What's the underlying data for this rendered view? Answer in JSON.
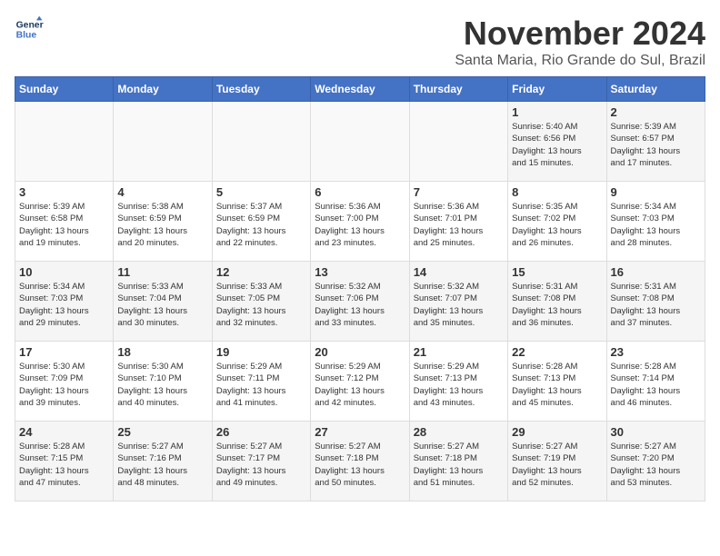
{
  "header": {
    "logo_line1": "General",
    "logo_line2": "Blue",
    "month": "November 2024",
    "location": "Santa Maria, Rio Grande do Sul, Brazil"
  },
  "weekdays": [
    "Sunday",
    "Monday",
    "Tuesday",
    "Wednesday",
    "Thursday",
    "Friday",
    "Saturday"
  ],
  "weeks": [
    [
      {
        "day": "",
        "info": ""
      },
      {
        "day": "",
        "info": ""
      },
      {
        "day": "",
        "info": ""
      },
      {
        "day": "",
        "info": ""
      },
      {
        "day": "",
        "info": ""
      },
      {
        "day": "1",
        "info": "Sunrise: 5:40 AM\nSunset: 6:56 PM\nDaylight: 13 hours\nand 15 minutes."
      },
      {
        "day": "2",
        "info": "Sunrise: 5:39 AM\nSunset: 6:57 PM\nDaylight: 13 hours\nand 17 minutes."
      }
    ],
    [
      {
        "day": "3",
        "info": "Sunrise: 5:39 AM\nSunset: 6:58 PM\nDaylight: 13 hours\nand 19 minutes."
      },
      {
        "day": "4",
        "info": "Sunrise: 5:38 AM\nSunset: 6:59 PM\nDaylight: 13 hours\nand 20 minutes."
      },
      {
        "day": "5",
        "info": "Sunrise: 5:37 AM\nSunset: 6:59 PM\nDaylight: 13 hours\nand 22 minutes."
      },
      {
        "day": "6",
        "info": "Sunrise: 5:36 AM\nSunset: 7:00 PM\nDaylight: 13 hours\nand 23 minutes."
      },
      {
        "day": "7",
        "info": "Sunrise: 5:36 AM\nSunset: 7:01 PM\nDaylight: 13 hours\nand 25 minutes."
      },
      {
        "day": "8",
        "info": "Sunrise: 5:35 AM\nSunset: 7:02 PM\nDaylight: 13 hours\nand 26 minutes."
      },
      {
        "day": "9",
        "info": "Sunrise: 5:34 AM\nSunset: 7:03 PM\nDaylight: 13 hours\nand 28 minutes."
      }
    ],
    [
      {
        "day": "10",
        "info": "Sunrise: 5:34 AM\nSunset: 7:03 PM\nDaylight: 13 hours\nand 29 minutes."
      },
      {
        "day": "11",
        "info": "Sunrise: 5:33 AM\nSunset: 7:04 PM\nDaylight: 13 hours\nand 30 minutes."
      },
      {
        "day": "12",
        "info": "Sunrise: 5:33 AM\nSunset: 7:05 PM\nDaylight: 13 hours\nand 32 minutes."
      },
      {
        "day": "13",
        "info": "Sunrise: 5:32 AM\nSunset: 7:06 PM\nDaylight: 13 hours\nand 33 minutes."
      },
      {
        "day": "14",
        "info": "Sunrise: 5:32 AM\nSunset: 7:07 PM\nDaylight: 13 hours\nand 35 minutes."
      },
      {
        "day": "15",
        "info": "Sunrise: 5:31 AM\nSunset: 7:08 PM\nDaylight: 13 hours\nand 36 minutes."
      },
      {
        "day": "16",
        "info": "Sunrise: 5:31 AM\nSunset: 7:08 PM\nDaylight: 13 hours\nand 37 minutes."
      }
    ],
    [
      {
        "day": "17",
        "info": "Sunrise: 5:30 AM\nSunset: 7:09 PM\nDaylight: 13 hours\nand 39 minutes."
      },
      {
        "day": "18",
        "info": "Sunrise: 5:30 AM\nSunset: 7:10 PM\nDaylight: 13 hours\nand 40 minutes."
      },
      {
        "day": "19",
        "info": "Sunrise: 5:29 AM\nSunset: 7:11 PM\nDaylight: 13 hours\nand 41 minutes."
      },
      {
        "day": "20",
        "info": "Sunrise: 5:29 AM\nSunset: 7:12 PM\nDaylight: 13 hours\nand 42 minutes."
      },
      {
        "day": "21",
        "info": "Sunrise: 5:29 AM\nSunset: 7:13 PM\nDaylight: 13 hours\nand 43 minutes."
      },
      {
        "day": "22",
        "info": "Sunrise: 5:28 AM\nSunset: 7:13 PM\nDaylight: 13 hours\nand 45 minutes."
      },
      {
        "day": "23",
        "info": "Sunrise: 5:28 AM\nSunset: 7:14 PM\nDaylight: 13 hours\nand 46 minutes."
      }
    ],
    [
      {
        "day": "24",
        "info": "Sunrise: 5:28 AM\nSunset: 7:15 PM\nDaylight: 13 hours\nand 47 minutes."
      },
      {
        "day": "25",
        "info": "Sunrise: 5:27 AM\nSunset: 7:16 PM\nDaylight: 13 hours\nand 48 minutes."
      },
      {
        "day": "26",
        "info": "Sunrise: 5:27 AM\nSunset: 7:17 PM\nDaylight: 13 hours\nand 49 minutes."
      },
      {
        "day": "27",
        "info": "Sunrise: 5:27 AM\nSunset: 7:18 PM\nDaylight: 13 hours\nand 50 minutes."
      },
      {
        "day": "28",
        "info": "Sunrise: 5:27 AM\nSunset: 7:18 PM\nDaylight: 13 hours\nand 51 minutes."
      },
      {
        "day": "29",
        "info": "Sunrise: 5:27 AM\nSunset: 7:19 PM\nDaylight: 13 hours\nand 52 minutes."
      },
      {
        "day": "30",
        "info": "Sunrise: 5:27 AM\nSunset: 7:20 PM\nDaylight: 13 hours\nand 53 minutes."
      }
    ]
  ]
}
